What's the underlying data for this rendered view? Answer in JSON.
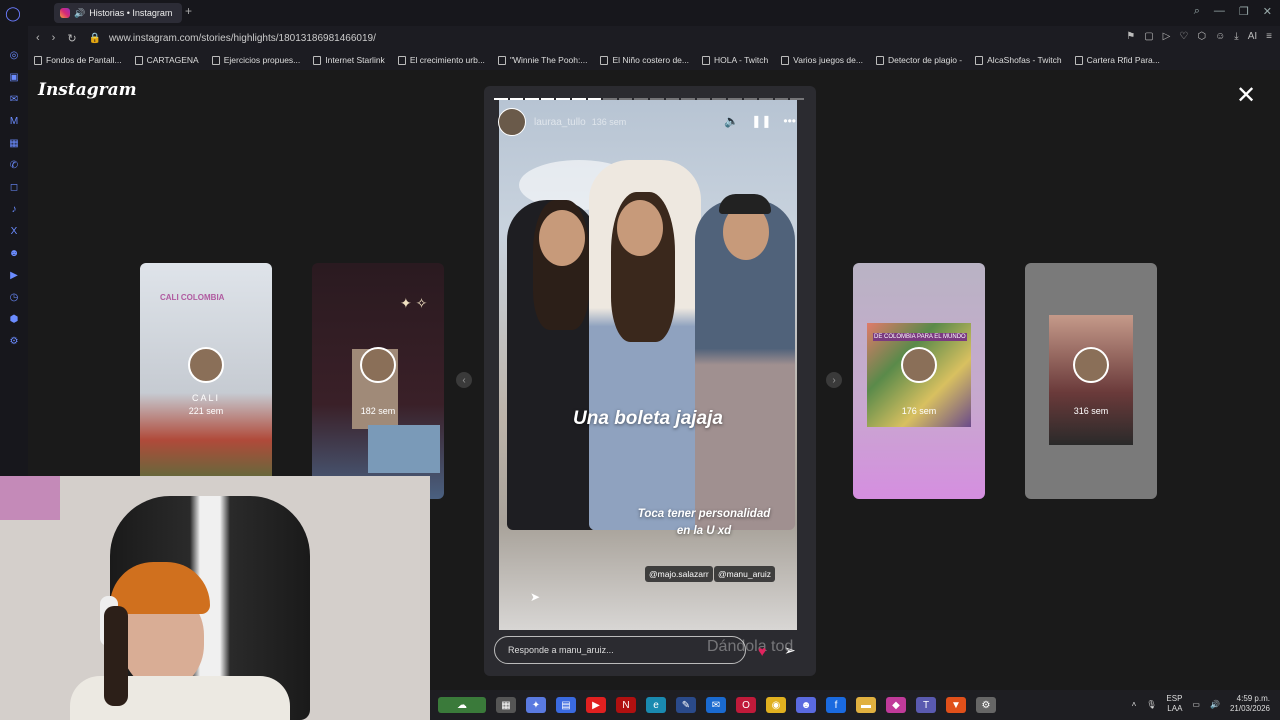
{
  "browser": {
    "tab_title": "Historias • Instagram",
    "url": "www.instagram.com/stories/highlights/18013186981466019/",
    "new_tab": "+",
    "ai_label": "AI"
  },
  "bookmarks": [
    "Fondos de Pantall...",
    "CARTAGENA",
    "Ejercicios propues...",
    "Internet Starlink",
    "El crecimiento urb...",
    "\"Winnie The Pooh:...",
    "El Niño costero de...",
    "HOLA - Twitch",
    "Varios juegos de...",
    "Detector de plagio -",
    "AlcaShofas - Twitch",
    "Cartera Rfid Para..."
  ],
  "instagram": {
    "logo": "Instagram",
    "close": "✕"
  },
  "side_stories": [
    {
      "label": "CALI",
      "age": "221 sem",
      "overlay_text": "CALI COLOMBIA"
    },
    {
      "label": "",
      "age": "182 sem"
    },
    {
      "label": "",
      "age": "176 sem",
      "overlay_text": "DE COLOMBIA PARA EL MUNDO"
    },
    {
      "label": "",
      "age": "316 sem"
    }
  ],
  "story": {
    "username": "lauraa_tullo",
    "time": "136 sem",
    "caption_main": "Una boleta jajaja",
    "caption_sub": "Toca tener personalidad en la U xd",
    "mentions": [
      "@majo.salazarr",
      "@manu_aruiz"
    ],
    "reply_placeholder": "Responde a manu_aruiz...",
    "watermark": "Dándola tod",
    "progress_total": 20,
    "progress_done": 7
  },
  "taskbar": {
    "lang_top": "ESP",
    "lang_bottom": "LAA",
    "time": "4:59 p.m.",
    "date": "21/03/2026"
  }
}
